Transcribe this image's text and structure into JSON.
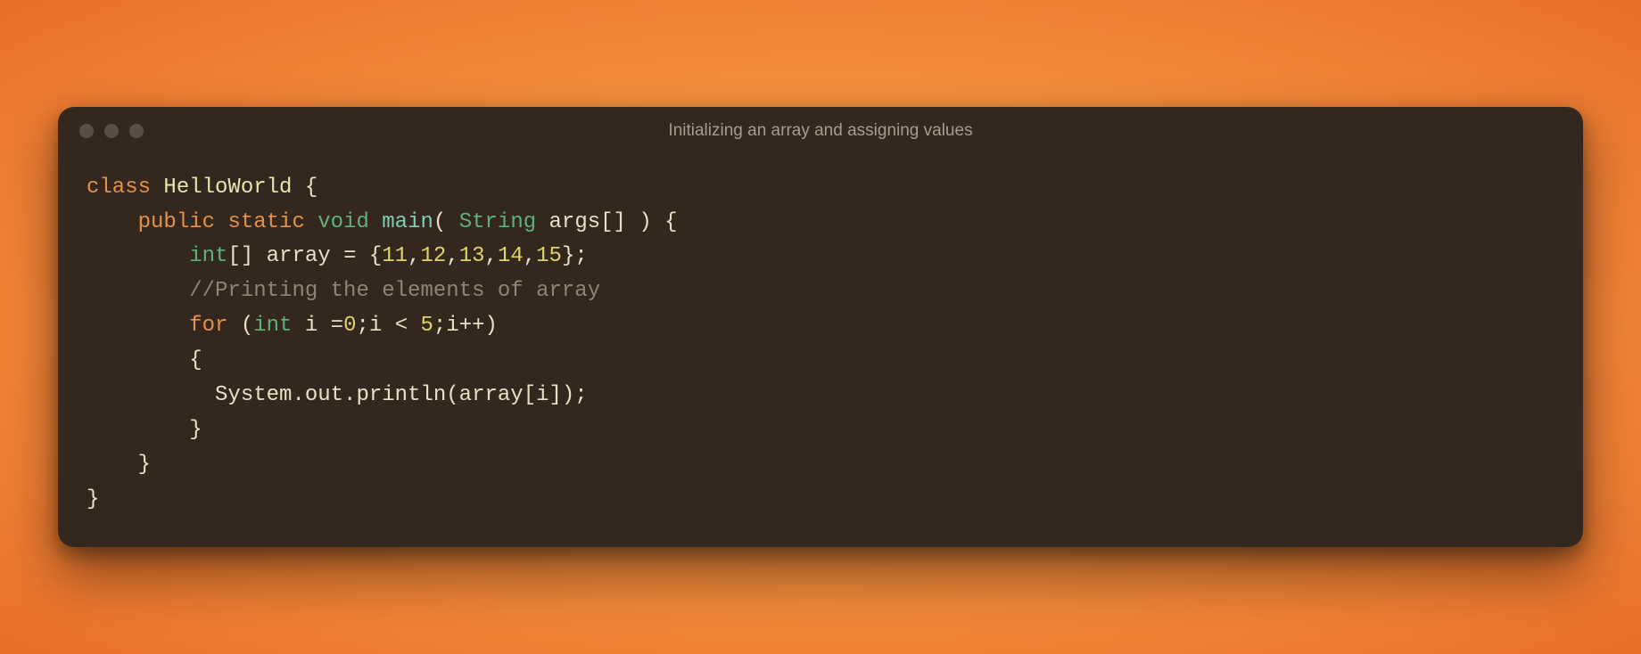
{
  "window": {
    "title": "Initializing an array and assigning values"
  },
  "code": {
    "kw_class": "class",
    "class_name": "HelloWorld",
    "open_brace": " {",
    "indent1": "    ",
    "kw_public": "public",
    "kw_static": "static",
    "kw_void": "void",
    "fn_main": "main",
    "paren_open_sp": "( ",
    "type_string": "String",
    "args_decl": " args[] ) {",
    "indent2": "        ",
    "type_int_arr": "int",
    "int_brackets": "[]",
    "array_eq": " array = {",
    "n11": "11",
    "comma": ",",
    "n12": "12",
    "n13": "13",
    "n14": "14",
    "n15": "15",
    "arr_close": "};",
    "comment": "//Printing the elements of array",
    "kw_for": "for",
    "for_open": " (",
    "type_int": "int",
    "i_eq": " i =",
    "zero": "0",
    "semi": ";",
    "i_lt": "i < ",
    "five": "5",
    "ipp_close": ";i++)",
    "brace_open": "{",
    "indent3": "          ",
    "println_call": "System.out.println(array[i]);",
    "brace_close": "}",
    "end_brace": "}"
  }
}
